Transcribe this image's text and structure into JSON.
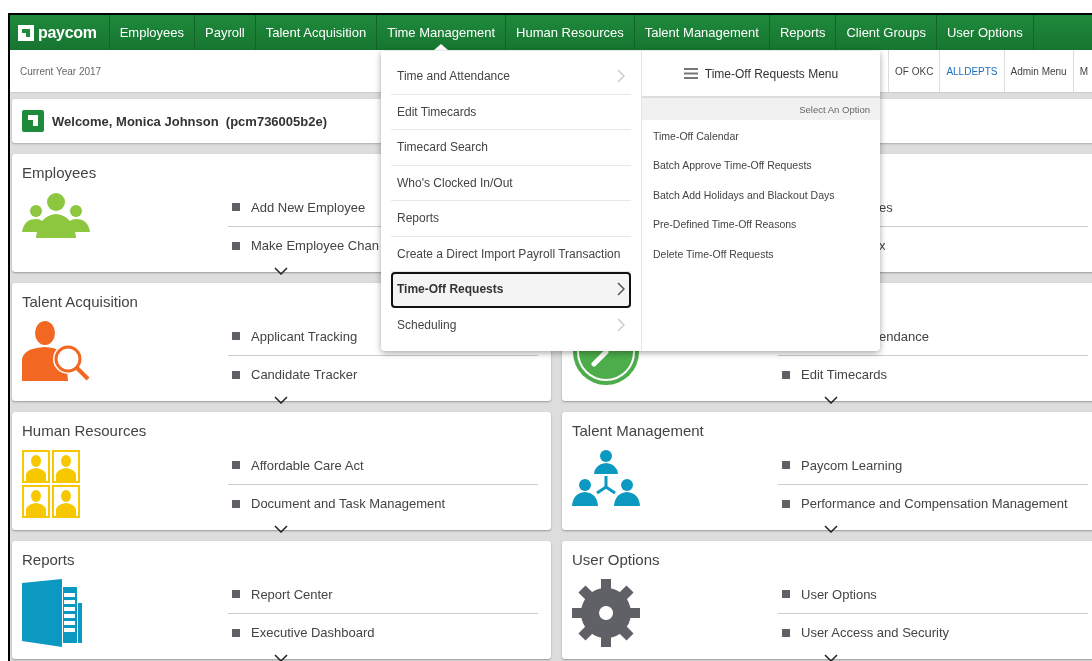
{
  "nav": {
    "logo": "paycom",
    "items": [
      {
        "label": "Employees",
        "selected": false
      },
      {
        "label": "Payroll",
        "selected": false
      },
      {
        "label": "Talent Acquisition",
        "selected": false
      },
      {
        "label": "Time Management",
        "selected": true
      },
      {
        "label": "Human Resources",
        "selected": false
      },
      {
        "label": "Talent Management",
        "selected": false
      },
      {
        "label": "Reports",
        "selected": false
      },
      {
        "label": "Client Groups",
        "selected": false
      },
      {
        "label": "User Options",
        "selected": false
      }
    ]
  },
  "subbar": {
    "year": "Current Year 2017",
    "links": [
      {
        "label": "OF OKC",
        "kind": "plain"
      },
      {
        "label": "ALLDEPTS",
        "kind": "link"
      },
      {
        "label": "Admin Menu",
        "kind": "plain"
      },
      {
        "label": "M",
        "kind": "plain"
      }
    ]
  },
  "welcome": "Welcome, Monica Johnson  (pcm736005b2e)",
  "cards": [
    {
      "title": "Employees",
      "kind": "people",
      "items": [
        {
          "label": "Add New Employee",
          "kind": "full"
        },
        {
          "label": "Make Employee Chan",
          "kind": "full"
        }
      ]
    },
    {
      "items": [
        {
          "label": "es",
          "kind": "covered"
        },
        {
          "label": "x",
          "kind": "covered"
        }
      ]
    },
    {
      "title": "Talent Acquisition",
      "kind": "search-person",
      "items": [
        {
          "label": "Applicant Tracking",
          "kind": "full"
        },
        {
          "label": "Candidate Tracker",
          "kind": "full"
        }
      ]
    },
    {
      "kind": "clock",
      "items": [
        {
          "label": "endance",
          "kind": "covered"
        },
        {
          "label": "Edit Timecards",
          "kind": "full"
        }
      ]
    },
    {
      "title": "Human Resources",
      "kind": "portraits",
      "items": [
        {
          "label": "Affordable Care Act",
          "kind": "full"
        },
        {
          "label": "Document and Task Management",
          "kind": "full"
        }
      ]
    },
    {
      "title": "Talent Management",
      "kind": "team",
      "items": [
        {
          "label": "Paycom Learning",
          "kind": "full"
        },
        {
          "label": "Performance and Compensation Management",
          "kind": "full"
        }
      ]
    },
    {
      "title": "Reports",
      "kind": "book",
      "items": [
        {
          "label": "Report Center",
          "kind": "full"
        },
        {
          "label": "Executive Dashboard",
          "kind": "full"
        }
      ]
    },
    {
      "title": "User Options",
      "kind": "gear",
      "items": [
        {
          "label": "User Options",
          "kind": "full"
        },
        {
          "label": "User Access and Security",
          "kind": "full"
        }
      ]
    }
  ],
  "menu": {
    "items": [
      {
        "label": "Time and Attendance",
        "selected": false,
        "has_submenu": true
      },
      {
        "label": "Edit Timecards",
        "selected": false,
        "has_submenu": false
      },
      {
        "label": "Timecard Search",
        "selected": false,
        "has_submenu": false
      },
      {
        "label": "Who's Clocked In/Out",
        "selected": false,
        "has_submenu": false
      },
      {
        "label": "Reports",
        "selected": false,
        "has_submenu": false
      },
      {
        "label": "Create a Direct Import Payroll Transaction",
        "selected": false,
        "has_submenu": false
      },
      {
        "label": "Time-Off Requests",
        "selected": true,
        "has_submenu": true
      },
      {
        "label": "Scheduling",
        "selected": false,
        "has_submenu": true
      }
    ],
    "submenu": {
      "title": "Time-Off Requests Menu",
      "hint": "Select An Option",
      "items": [
        "Time-Off Calendar",
        "Batch Approve Time-Off Requests",
        "Batch Add Holidays and Blackout Days",
        "Pre-Defined Time-Off Reasons",
        "Delete Time-Off Requests"
      ]
    }
  }
}
